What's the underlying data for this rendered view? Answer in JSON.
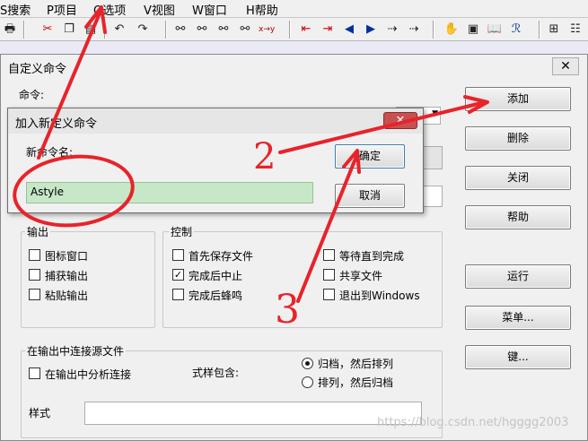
{
  "menu": {
    "items": [
      "S搜索",
      "P项目",
      "O选项",
      "V视图",
      "W窗口",
      "H帮助"
    ]
  },
  "main_dialog": {
    "title": "自定义命令",
    "command_label": "命令:",
    "buttons": {
      "add": "添加",
      "delete": "删除",
      "close": "关闭",
      "help": "帮助",
      "run": "运行",
      "menu": "菜单...",
      "key": "键..."
    },
    "output_group": {
      "title": "输出",
      "options": [
        {
          "label": "图标窗口",
          "checked": false
        },
        {
          "label": "捕获输出",
          "checked": false
        },
        {
          "label": "粘贴输出",
          "checked": false
        }
      ]
    },
    "control_group": {
      "title": "控制",
      "options": [
        {
          "label": "首先保存文件",
          "checked": false
        },
        {
          "label": "完成后中止",
          "checked": true
        },
        {
          "label": "完成后蜂鸣",
          "checked": false
        },
        {
          "label": "等待直到完成",
          "checked": false
        },
        {
          "label": "共享文件",
          "checked": false
        },
        {
          "label": "退出到Windows",
          "checked": false
        }
      ]
    },
    "link_group": {
      "title": "在输出中连接源文件",
      "parse_label": "在输出中分析连接",
      "parse_checked": false,
      "pattern_label": "式样包含:",
      "radio_options": [
        {
          "label": "归档，然后排列",
          "selected": true
        },
        {
          "label": "排列，然后归档",
          "selected": false
        }
      ],
      "style_label": "样式",
      "style_value": ""
    }
  },
  "sub_dialog": {
    "title": "加入新定义命令",
    "name_label": "新命令名:",
    "name_value": "Astyle",
    "ok_label": "确定",
    "cancel_label": "取消"
  },
  "annotations": {
    "labels": [
      "2",
      "3"
    ],
    "color": "#e8232a"
  },
  "watermark": "https://blog.csdn.net/hgggg2003"
}
